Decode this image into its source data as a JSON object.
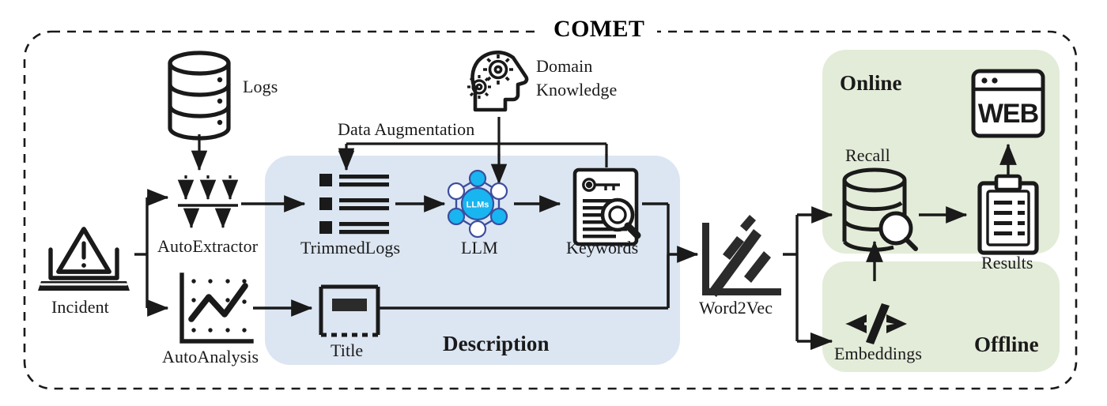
{
  "diagram": {
    "title": "COMET",
    "type": "system-architecture-flow-diagram",
    "outer_boundary_style": "dashed-rounded-rectangle"
  },
  "colors": {
    "description_panel": "#dce6f2",
    "online_offline_panel": "#e3ecd8",
    "stroke": "#1a1a1a",
    "llm_node_cyan": "#19b5f0",
    "llm_node_outline": "#3b4ea0",
    "background": "#ffffff"
  },
  "nodes": {
    "incident": {
      "label": "Incident",
      "icon": "incident-laptop-warning-icon"
    },
    "logs": {
      "label": "Logs",
      "icon": "database-cylinder-icon"
    },
    "domain_knowledge": {
      "label": "Domain\nKnowledge",
      "line1": "Domain",
      "line2": "Knowledge",
      "icon": "head-gears-icon"
    },
    "auto_extractor": {
      "label": "AutoExtractor",
      "icon": "downward-arrows-filter-icon"
    },
    "auto_analysis": {
      "label": "AutoAnalysis",
      "icon": "line-chart-icon"
    },
    "trimmed_logs": {
      "label": "TrimmedLogs",
      "icon": "bulleted-list-icon"
    },
    "llm": {
      "label": "LLM",
      "icon": "neural-node-graph-icon",
      "badge": "LLMs"
    },
    "keywords": {
      "label": "Keywords",
      "icon": "document-key-magnifier-icon"
    },
    "title_block": {
      "label": "Title",
      "icon": "title-box-icon"
    },
    "word2vec": {
      "label": "Word2Vec",
      "icon": "vector-axis-slashes-icon"
    },
    "recall": {
      "label": "Recall",
      "icon": "database-search-icon"
    },
    "results": {
      "label": "Results",
      "icon": "clipboard-list-icon"
    },
    "web": {
      "label": "WEB",
      "icon": "browser-window-icon"
    },
    "embeddings": {
      "label": "Embeddings",
      "icon": "code-brackets-icon"
    }
  },
  "panels": {
    "description": {
      "label": "Description",
      "icon": "description-panel"
    },
    "online": {
      "label": "Online",
      "icon": "online-panel"
    },
    "offline": {
      "label": "Offline",
      "icon": "offline-panel"
    }
  },
  "edges": {
    "data_augmentation": {
      "label": "Data Augmentation"
    }
  }
}
